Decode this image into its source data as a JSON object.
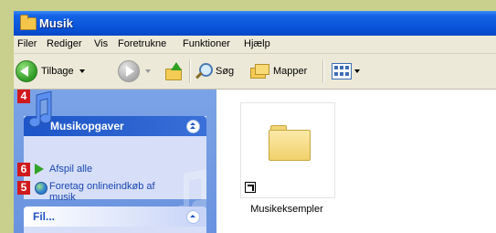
{
  "window": {
    "title": "Musik"
  },
  "menu": [
    "Filer",
    "Rediger",
    "Vis",
    "Foretrukne",
    "Funktioner",
    "Hjælp"
  ],
  "toolbar": {
    "back_label": "Tilbage",
    "search_label": "Søg",
    "folders_label": "Mapper"
  },
  "taskpane": {
    "header": "Musikopgaver",
    "links": [
      {
        "badge": "6",
        "label": "Afspil alle"
      },
      {
        "badge": "5",
        "label_line1": "Foretag onlineindkøb af",
        "label_line2": "musik"
      }
    ],
    "header_badge": "4",
    "second_panel_header": "Fil..."
  },
  "content": {
    "items": [
      {
        "label": "Musikeksempler",
        "icon": "folder-shortcut-icon"
      }
    ]
  },
  "colors": {
    "titlebar": "#0a56db",
    "badge": "#d0191c",
    "link": "#1b45b0",
    "sidebar": "#7ba3e6"
  }
}
